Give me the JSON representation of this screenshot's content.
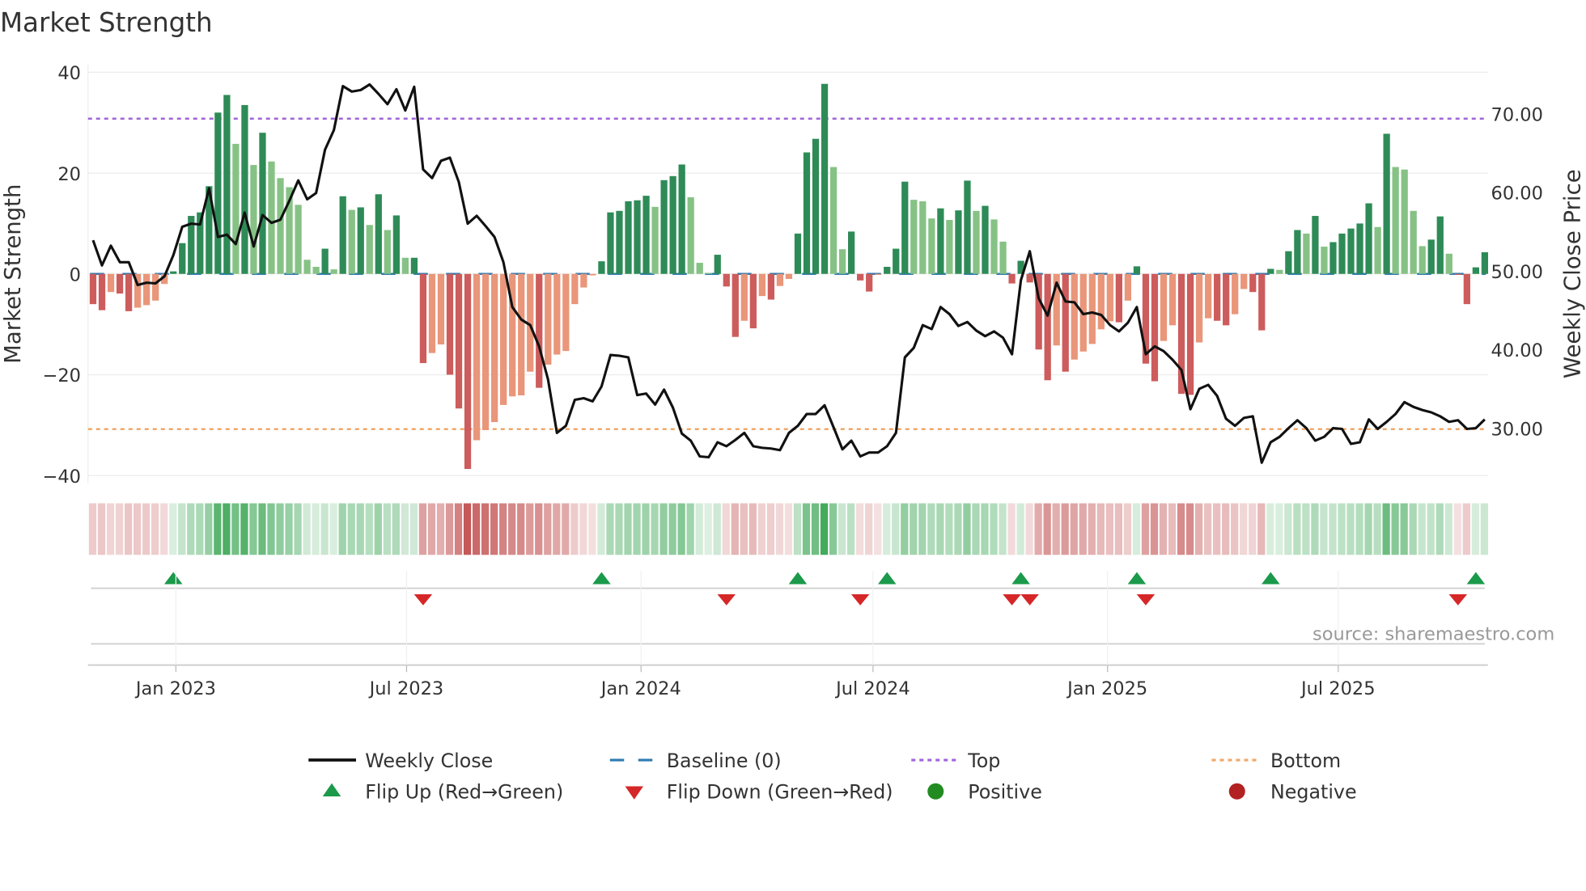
{
  "title": "Market Strength",
  "source": "source: sharemaestro.com",
  "colors": {
    "strong_up": "#2e8b57",
    "weak_up": "#86c285",
    "strong_down": "#cd5c5c",
    "weak_down": "#e9967a",
    "close": "#111111",
    "baseline": "#2f7bb0",
    "top": "#a064d8",
    "bottom": "#f0a868",
    "flip_up": "#1a9a4a",
    "flip_down": "#d62728",
    "positive": "#228b22",
    "negative": "#b22222"
  },
  "legend": {
    "weekly_close": "Weekly Close",
    "baseline": "Baseline (0)",
    "top": "Top",
    "bottom": "Bottom",
    "flip_up": "Flip Up (Red→Green)",
    "flip_down": "Flip Down (Green→Red)",
    "positive": "Positive",
    "negative": "Negative"
  },
  "chart_data": {
    "type": "bar",
    "title": "Market Strength",
    "ylabel": "Market Strength",
    "y2label": "Weekly Close Price",
    "ylim": [
      -40,
      40
    ],
    "y2lim": [
      23.9,
      75.2
    ],
    "yticks": [
      40,
      20,
      0,
      -20,
      -40
    ],
    "yticklabels": [
      "40",
      "20",
      "0",
      "−20",
      "−40"
    ],
    "y2ticks": [
      70,
      60,
      50,
      40,
      30
    ],
    "y2ticklabels": [
      "70.00",
      "60.00",
      "50.00",
      "40.00",
      "30.00"
    ],
    "x_start": "2022-10-28",
    "x_interval": "weekly",
    "xticks": [
      "2023-01-01",
      "2023-07-01",
      "2024-01-01",
      "2024-07-01",
      "2025-01-01",
      "2025-07-01"
    ],
    "xticklabels": [
      "Jan 2023",
      "Jul 2023",
      "Jan 2024",
      "Jul 2024",
      "Jan 2025",
      "Jul 2025"
    ],
    "top_level": 30.8,
    "bottom_level": -30.8,
    "grid": true,
    "legend_position": "bottom",
    "series": [
      {
        "name": "Market Strength",
        "type": "bar",
        "values": [
          -6,
          -7.2,
          -3.6,
          -3.9,
          -7.4,
          -6.7,
          -6.2,
          -5.3,
          -2,
          0.5,
          6.1,
          11.5,
          12.2,
          17.4,
          32,
          35.5,
          25.8,
          33.5,
          21.6,
          28,
          22.3,
          19,
          17.2,
          13.7,
          2.8,
          1.4,
          5,
          0.9,
          15.4,
          12.7,
          13.2,
          9.7,
          15.8,
          8.7,
          11.6,
          3.2,
          3.2,
          -17.7,
          -15.7,
          -14,
          -20,
          -26.7,
          -38.7,
          -33,
          -31,
          -29.4,
          -26,
          -24.3,
          -24.1,
          -19.4,
          -22.6,
          -18,
          -16,
          -15.3,
          -6,
          -2.7,
          -0.3,
          2.5,
          12.2,
          12.5,
          14.4,
          14.6,
          15.5,
          13.3,
          18.6,
          19.4,
          21.7,
          15.2,
          2.2,
          0.2,
          3.8,
          -2.5,
          -12.5,
          -9.3,
          -10.8,
          -4.4,
          -5.1,
          -2.4,
          -1,
          8,
          24.1,
          26.8,
          37.7,
          21.2,
          4.9,
          8.4,
          -1.3,
          -3.5,
          -0.2,
          1.4,
          5,
          18.3,
          14.7,
          14.4,
          11,
          13,
          10.7,
          12.6,
          18.5,
          12.5,
          13.5,
          10.8,
          6.4,
          -1.9,
          2.6,
          -1.7,
          -15,
          -21.1,
          -14.2,
          -19.4,
          -17,
          -15.4,
          -13.9,
          -11,
          -9.4,
          -9.6,
          -5.3,
          1.5,
          -17.8,
          -21.3,
          -13.3,
          -10.2,
          -23.8,
          -24,
          -13.6,
          -8.8,
          -9.3,
          -10.2,
          -8,
          -3,
          -3.6,
          -11.2,
          1,
          0.8,
          4.5,
          8.7,
          8,
          11.5,
          5.4,
          6.3,
          8,
          9,
          10,
          14,
          9.3,
          27.8,
          21.2,
          20.7,
          12.5,
          5.5,
          6.8,
          11.4,
          4,
          -0.2,
          -6,
          1.3,
          4.3
        ]
      },
      {
        "name": "Weekly Close",
        "type": "line",
        "axis": "right",
        "values": [
          53.9,
          50.7,
          53.2,
          51.1,
          51.1,
          48.2,
          48.5,
          48.4,
          49.3,
          52,
          55.6,
          56,
          55.9,
          60.5,
          54.3,
          54.6,
          53.4,
          57.4,
          53.1,
          57.1,
          56.1,
          56.5,
          58.9,
          61.5,
          59.1,
          59.9,
          65.4,
          67.9,
          73.5,
          72.8,
          73,
          73.7,
          72.5,
          71.2,
          73.1,
          70.4,
          73.4,
          62.9,
          61.8,
          64,
          64.4,
          61.3,
          56,
          57,
          55.7,
          54.3,
          51.1,
          45.4,
          43.8,
          43.1,
          40.4,
          36.2,
          29.4,
          30.3,
          33.6,
          33.8,
          33.4,
          35.3,
          39.3,
          39.2,
          39,
          34.2,
          34.4,
          33,
          34.9,
          32.6,
          29.3,
          28.4,
          26.4,
          26.3,
          28.2,
          27.7,
          28.5,
          29.4,
          27.7,
          27.5,
          27.4,
          27.2,
          29.4,
          30.3,
          31.8,
          31.8,
          32.9,
          30.1,
          27.3,
          28.4,
          26.4,
          26.9,
          26.9,
          27.7,
          29.4,
          39,
          40.2,
          43.1,
          42.6,
          45.4,
          44.5,
          43,
          43.5,
          42.4,
          41.7,
          42.3,
          41.5,
          39.4,
          48.8,
          52.5,
          46.5,
          44.3,
          48.5,
          46.1,
          46,
          44.5,
          44.7,
          44.4,
          43.1,
          42.3,
          43.4,
          45.4,
          39.4,
          40.4,
          39.8,
          38.7,
          37.4,
          32.4,
          35,
          35.5,
          34.1,
          31.2,
          30.3,
          31.3,
          31.5,
          25.6,
          28.2,
          28.9,
          30,
          31,
          30,
          28.4,
          28.9,
          30,
          29.9,
          28,
          28.2,
          31.1,
          29.9,
          30.8,
          31.8,
          33.3,
          32.7,
          32.3,
          32,
          31.5,
          30.8,
          31,
          29.9,
          30,
          31.1
        ]
      }
    ]
  }
}
